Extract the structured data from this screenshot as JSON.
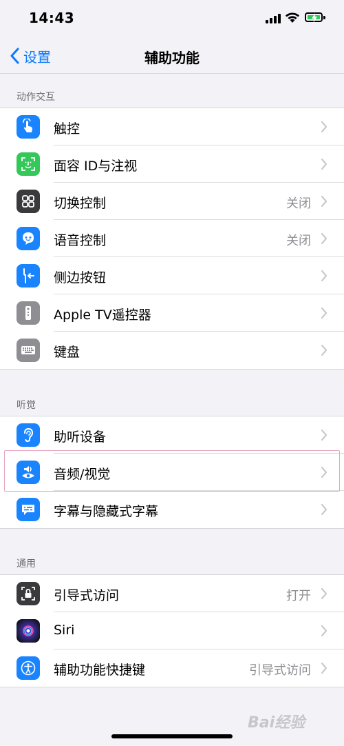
{
  "status": {
    "time": "14:43"
  },
  "nav": {
    "back_label": "设置",
    "title": "辅助功能"
  },
  "sections": [
    {
      "header": "动作交互",
      "rows": [
        {
          "label": "触控",
          "value": "",
          "icon": "touch-icon",
          "color": "#1a84ff"
        },
        {
          "label": "面容 ID与注视",
          "value": "",
          "icon": "face-id-icon",
          "color": "#34c759"
        },
        {
          "label": "切换控制",
          "value": "关闭",
          "icon": "switch-control-icon",
          "color": "#3a3a3c"
        },
        {
          "label": "语音控制",
          "value": "关闭",
          "icon": "voice-control-icon",
          "color": "#1a84ff"
        },
        {
          "label": "侧边按钮",
          "value": "",
          "icon": "side-button-icon",
          "color": "#1a84ff"
        },
        {
          "label": "Apple TV遥控器",
          "value": "",
          "icon": "remote-icon",
          "color": "#8e8e93"
        },
        {
          "label": "键盘",
          "value": "",
          "icon": "keyboard-icon",
          "color": "#8e8e93"
        }
      ]
    },
    {
      "header": "听觉",
      "rows": [
        {
          "label": "助听设备",
          "value": "",
          "icon": "ear-icon",
          "color": "#1a84ff"
        },
        {
          "label": "音频/视觉",
          "value": "",
          "icon": "audio-visual-icon",
          "color": "#1a84ff"
        },
        {
          "label": "字幕与隐藏式字幕",
          "value": "",
          "icon": "subtitles-icon",
          "color": "#1a84ff"
        }
      ]
    },
    {
      "header": "通用",
      "rows": [
        {
          "label": "引导式访问",
          "value": "打开",
          "icon": "guided-access-icon",
          "color": "#3a3a3c"
        },
        {
          "label": "Siri",
          "value": "",
          "icon": "siri-icon",
          "color": "#1c1c3a"
        },
        {
          "label": "辅助功能快捷键",
          "value": "引导式访问",
          "icon": "accessibility-icon",
          "color": "#1a84ff"
        }
      ]
    }
  ],
  "watermark": "Bai经验"
}
